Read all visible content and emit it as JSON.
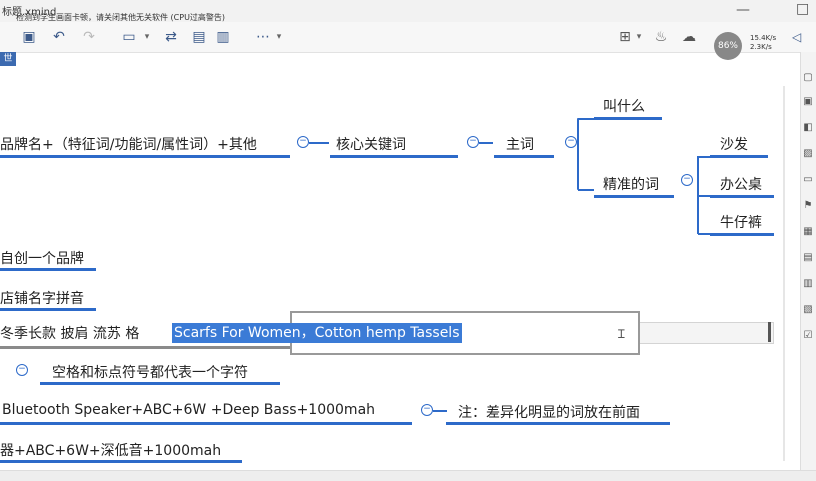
{
  "window": {
    "title": "标题.xmind",
    "notice": "检测到学生画面卡顿，请关闭其他无关软件 (CPU过高警告)"
  },
  "toolbar": {
    "items": [
      "save-icon",
      "undo-icon",
      "redo-icon",
      "insert-icon",
      "swap-icon",
      "doc-icon",
      "doc2-icon",
      "more-icon",
      "image-icon",
      "bulb-icon",
      "cloud-icon",
      "download-icon"
    ]
  },
  "system": {
    "speed_label": "86%",
    "net_up": "15.4K/s",
    "net_down": "2.3K/s"
  },
  "tab_label": "世",
  "mindmap": {
    "formula": "品牌名+（特征词/功能词/属性词）+其他",
    "core": "核心关键词",
    "main": "主词",
    "what": "叫什么",
    "precise": "精准的词",
    "leaves": [
      "沙发",
      "办公桌",
      "牛仔裤"
    ],
    "own_brand": "自创一个品牌",
    "shop_pinyin": "店铺名字拼音",
    "example_prefix": "冬季长款  披肩  流苏  格",
    "selected_text": "Scarfs For Women，Cotton hemp Tassels",
    "space_note": "空格和标点符号都代表一个字符",
    "bluetooth": "Bluetooth   Speaker+ABC+6W +Deep  Bass+1000mah",
    "note": "注：差异化明显的词放在前面",
    "chinese_example": "器+ABC+6W+深低音+1000mah"
  }
}
